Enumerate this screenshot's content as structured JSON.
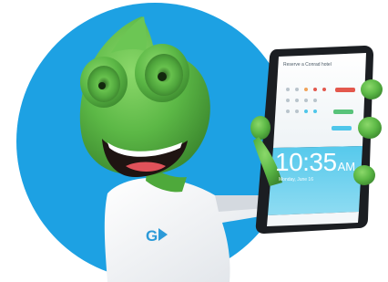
{
  "phone": {
    "app_title": "Reserve a Conrad hotel",
    "time": "10:35",
    "ampm": "AM",
    "date_line": "Monday, June 16"
  },
  "shirt": {
    "logo_text": "G"
  },
  "colors": {
    "circle_blue": "#1da1e3",
    "chameleon_green": "#5cb846",
    "shirt_white": "#f6f7f9",
    "phone_accent_blue": "#4fc6ea",
    "phone_body": "#1b1e22",
    "logo_blue": "#2c9ad8"
  },
  "icons": {
    "shirt_logo": "g-arrow-logo"
  }
}
